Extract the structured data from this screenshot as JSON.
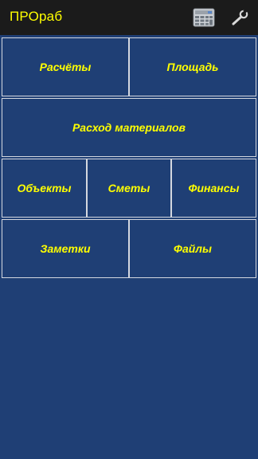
{
  "app": {
    "title": "ПРОраб"
  },
  "toolbar": {
    "icons": [
      "calculator-icon",
      "wrench-icon"
    ]
  },
  "menu": {
    "rows": [
      [
        "Расчёты",
        "Площадь"
      ],
      [
        "Расход материалов"
      ],
      [
        "Объекты",
        "Сметы",
        "Финансы"
      ],
      [
        "Заметки",
        "Файлы"
      ]
    ]
  },
  "colors": {
    "background": "#1f3f75",
    "appbar": "#1b1b1b",
    "accent_text": "#ffff00",
    "tile_border": "#d4d8e0"
  }
}
